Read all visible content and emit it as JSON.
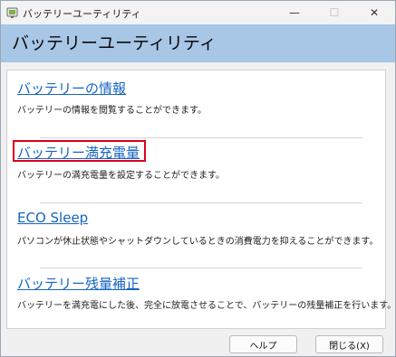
{
  "window": {
    "title": "バッテリーユーティリティ",
    "minimize_glyph": "—",
    "maximize_glyph": "☐",
    "close_glyph": "✕"
  },
  "header": {
    "title": "バッテリーユーティリティ"
  },
  "items": [
    {
      "link": "バッテリーの情報",
      "desc": "バッテリーの情報を閲覧することができます。"
    },
    {
      "link": "バッテリー満充電量",
      "desc": "バッテリーの満充電量を設定することができます。"
    },
    {
      "link": "ECO Sleep",
      "desc": "パソコンが休止状態やシャットダウンしているときの消費電力を抑えることができます。"
    },
    {
      "link": "バッテリー残量補正",
      "desc": "バッテリーを満充電にした後、完全に放電させることで、バッテリーの残量補正を行います。"
    }
  ],
  "buttons": {
    "help": "ヘルプ",
    "close": "閉じる(X)"
  },
  "colors": {
    "header_bg": "#a8c6e6",
    "link": "#1565c0",
    "highlight": "#d9001b"
  }
}
